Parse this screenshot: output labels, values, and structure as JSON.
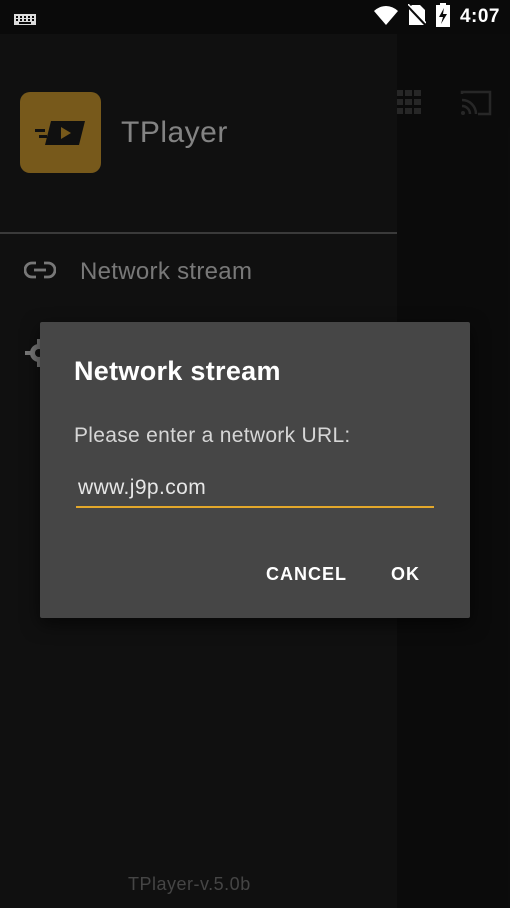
{
  "status_bar": {
    "time": "4:07",
    "icons": [
      "keyboard-icon",
      "wifi-icon",
      "no-sim-icon",
      "battery-charging-icon"
    ]
  },
  "app_bar": {
    "icons": [
      "grid-view-icon",
      "cast-icon"
    ]
  },
  "drawer": {
    "app_title": "TPlayer",
    "items": [
      {
        "label": "Network stream",
        "icon": "link-icon"
      },
      {
        "label": "",
        "icon": "gear-icon"
      }
    ],
    "version": "TPlayer-v.5.0b"
  },
  "dialog": {
    "title": "Network stream",
    "message": "Please enter a network URL:",
    "url_value": "www.j9p.com",
    "cancel_label": "CANCEL",
    "ok_label": "OK"
  },
  "colors": {
    "accent": "#e3a82b",
    "logo_bg": "#b7892a",
    "dialog_bg": "#464646"
  }
}
